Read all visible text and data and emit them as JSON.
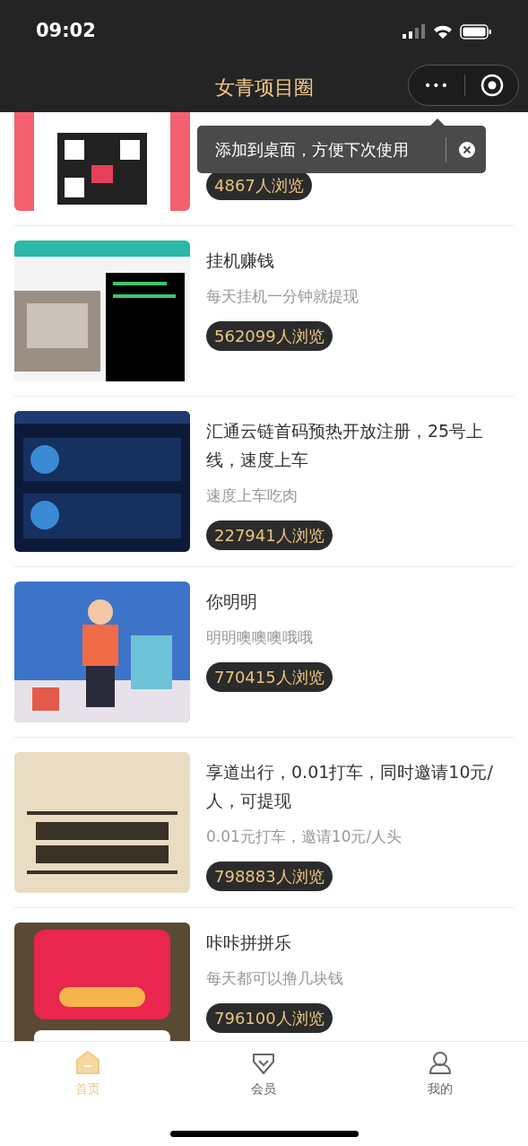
{
  "status_bar": {
    "time": "09:02"
  },
  "nav": {
    "title": "女青项目圈",
    "capsule_more": "•••"
  },
  "tooltip": {
    "text": "添加到桌面，方便下次使用"
  },
  "items": [
    {
      "views": "4867人浏览"
    },
    {
      "title": "挂机赚钱",
      "subtitle": "每天挂机一分钟就提现",
      "views": "562099人浏览"
    },
    {
      "title": "汇通云链首码预热开放注册，25号上线，速度上车",
      "subtitle": "速度上车吃肉",
      "views": "227941人浏览"
    },
    {
      "title": "你明明",
      "subtitle": "明明噢噢噢哦哦",
      "views": "770415人浏览"
    },
    {
      "title": "享道出行，0.01打车，同时邀请10元/人，可提现",
      "subtitle": "0.01元打车，邀请10元/人头",
      "views": "798883人浏览"
    },
    {
      "title": "咔咔拼拼乐",
      "subtitle": "每天都可以撸几块钱",
      "views": "796100人浏览"
    }
  ],
  "tabs": [
    {
      "kind": "home",
      "label": "首页",
      "selected": true
    },
    {
      "kind": "vip",
      "label": "会员",
      "selected": false
    },
    {
      "kind": "me",
      "label": "我的",
      "selected": false
    }
  ]
}
